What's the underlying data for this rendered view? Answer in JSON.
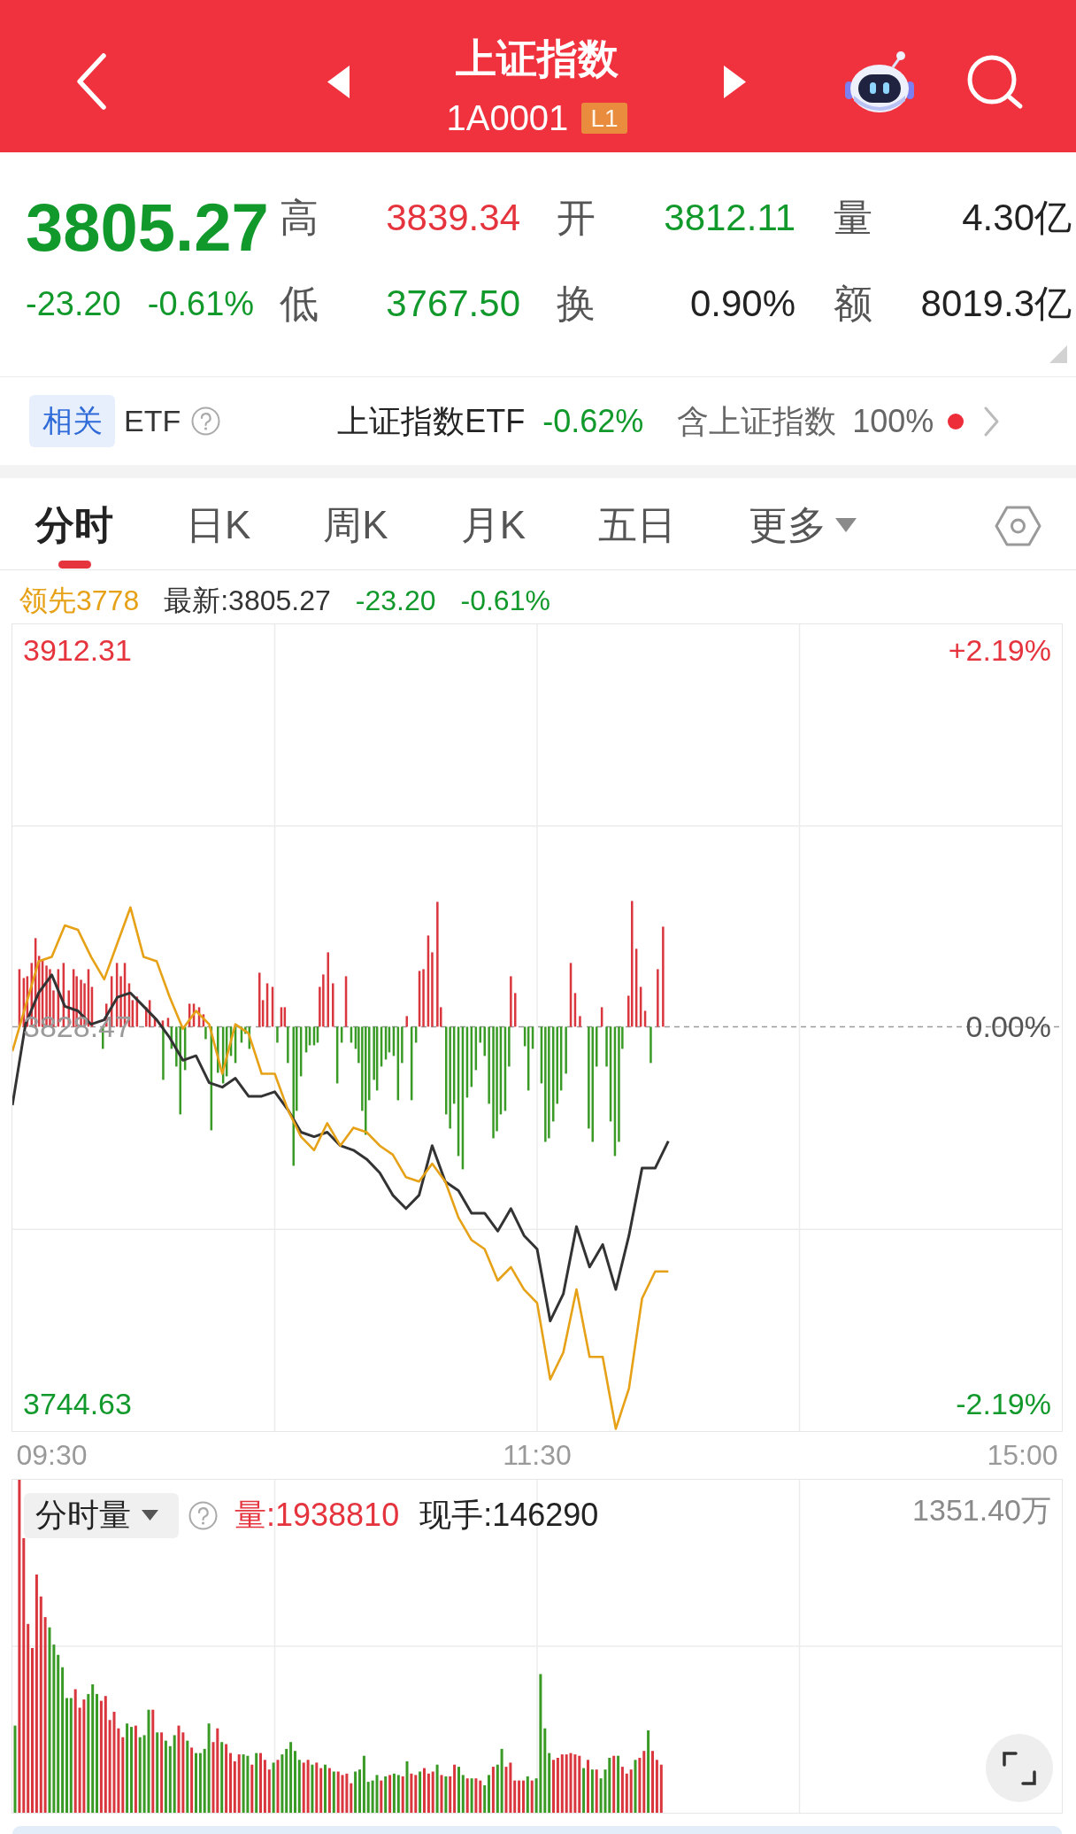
{
  "header": {
    "title": "上证指数",
    "code": "1A0001",
    "badge": "L1"
  },
  "quote": {
    "price": {
      "text": "3805.27",
      "color": "#12992b"
    },
    "change": {
      "text": "-23.20",
      "color": "#12992b"
    },
    "change_percent": {
      "text": "-0.61%",
      "color": "#12992b"
    },
    "stats": [
      {
        "label": "高",
        "value": "3839.34",
        "color": "#e5343d"
      },
      {
        "label": "开",
        "value": "3812.11",
        "color": "#12992b"
      },
      {
        "label": "量",
        "value": "4.30亿",
        "color": "#222222"
      },
      {
        "label": "低",
        "value": "3767.50",
        "color": "#12992b"
      },
      {
        "label": "换",
        "value": "0.90%",
        "color": "#222222"
      },
      {
        "label": "额",
        "value": "8019.3亿",
        "color": "#222222"
      }
    ]
  },
  "related_etf": {
    "tag": "相关",
    "label": "ETF",
    "name": "上证指数ETF",
    "change": {
      "text": "-0.62%",
      "color": "#12992b"
    },
    "holding_label": "含上证指数",
    "holding_value": "100%",
    "unread": true
  },
  "tabs": [
    {
      "label": "分时",
      "selected": true,
      "has_menu": false
    },
    {
      "label": "日K",
      "selected": false,
      "has_menu": false
    },
    {
      "label": "周K",
      "selected": false,
      "has_menu": false
    },
    {
      "label": "月K",
      "selected": false,
      "has_menu": false
    },
    {
      "label": "五日",
      "selected": false,
      "has_menu": false
    },
    {
      "label": "更多",
      "selected": false,
      "has_menu": true
    }
  ],
  "legend": {
    "leading": "领先3778",
    "latest": "最新:3805.27",
    "change": {
      "text": "-23.20",
      "color": "#12992b"
    },
    "change_percent": {
      "text": "-0.61%",
      "color": "#12992b"
    }
  },
  "intraday_chart": {
    "chart_data": {
      "type": "line",
      "categories": [
        null,
        null,
        null,
        "09:30",
        null,
        null,
        null,
        null,
        null,
        null,
        null,
        null,
        null,
        null,
        null,
        null,
        null,
        null,
        null,
        null,
        null,
        null,
        null,
        null,
        null,
        null,
        null,
        null,
        null,
        null,
        null,
        null,
        null,
        null,
        null,
        null,
        null,
        null,
        null,
        null,
        "11:30",
        null,
        null,
        null,
        null,
        null,
        null,
        null,
        null,
        null,
        null,
        null,
        null,
        null,
        null,
        null,
        null,
        null,
        null,
        null,
        null,
        null,
        null,
        null,
        null,
        null,
        null,
        null,
        null,
        null,
        null,
        null,
        null,
        null,
        null,
        null,
        null,
        "15:00",
        null,
        null,
        null
      ],
      "ylim": [
        3738.5,
        3918.0
      ],
      "yticks": [
        {
          "value": 3912.31,
          "label": "3912.31"
        },
        {
          "value": 3828.47,
          "label": "3828.47"
        },
        {
          "value": 3744.63,
          "label": "3744.63"
        }
      ],
      "series": [
        {
          "color": "#333333",
          "values": [
            3811,
            3829,
            3836,
            3840,
            3833,
            3832,
            3829,
            3830,
            3835,
            3836,
            3833,
            3830,
            3826,
            3821,
            3822,
            3816,
            3815,
            3817,
            3813,
            3813,
            3814,
            3810,
            3805,
            3804,
            3805,
            3802,
            3801,
            3799,
            3796,
            3791,
            3788,
            3791,
            3802,
            3794,
            3792,
            3787,
            3787,
            3783,
            3788,
            3782,
            3779,
            3763,
            3769,
            3784,
            3775,
            3780,
            3770,
            3782,
            3797,
            3797,
            3803,
            null,
            null,
            null,
            null,
            null,
            null,
            null,
            null,
            null,
            null,
            null,
            null,
            null,
            null,
            null,
            null,
            null,
            null,
            null,
            null,
            null,
            null,
            null,
            null,
            null,
            null,
            null,
            null,
            null,
            null
          ]
        },
        {
          "color": "#e6a117",
          "values": [
            3823,
            3833,
            3843,
            3844,
            3851,
            3850,
            3844,
            3839,
            3847,
            3855,
            3844,
            3843,
            3835,
            3828,
            3832,
            3829,
            3818,
            3829,
            3827,
            3818,
            3818,
            3810,
            3804,
            3801,
            3807,
            3802,
            3806,
            3805,
            3802,
            3800,
            3795,
            3794,
            3798,
            3794,
            3786,
            3781,
            3779,
            3772,
            3775,
            3770,
            3767,
            3750,
            3756,
            3770,
            3755,
            3755,
            3739,
            3748,
            3768,
            3774,
            3774,
            null,
            null,
            null,
            null,
            null,
            null,
            null,
            null,
            null,
            null,
            null,
            null,
            null,
            null,
            null,
            null,
            null,
            null,
            null,
            null,
            null,
            null,
            null,
            null,
            null,
            null,
            null,
            null,
            null,
            null
          ]
        }
      ]
    },
    "percent_labels": [
      "+2.19%",
      "0.00%",
      "-2.19%"
    ]
  },
  "volume_panel": {
    "selector": "分时量",
    "volume": "量:1938810",
    "current_hand": "现手:146290",
    "scale_max": "1351.40万"
  }
}
